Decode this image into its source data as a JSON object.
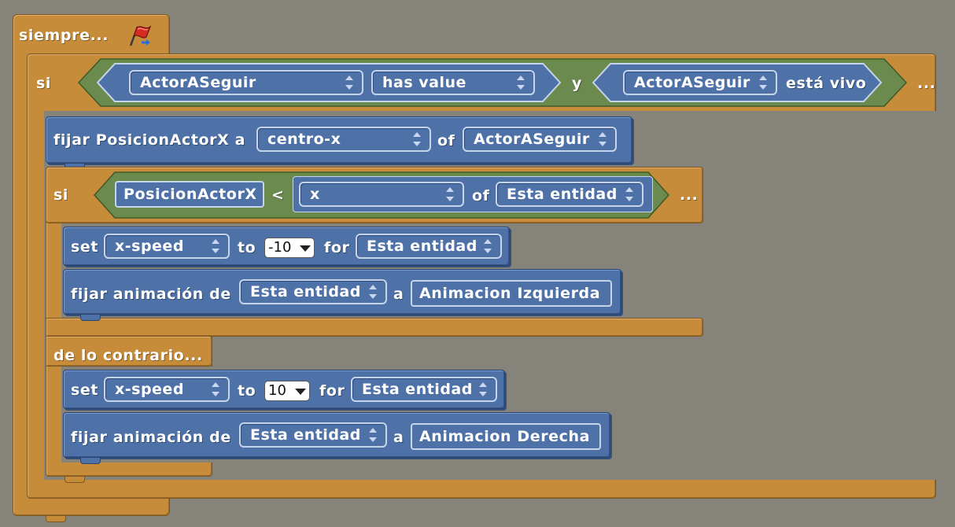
{
  "forever_block": {
    "label": "siempre...",
    "icon": "green-flag-icon"
  },
  "outer_if": {
    "label": "si",
    "more": "...",
    "condition": {
      "left": {
        "dropdown": "ActorASeguir",
        "operator": "has value"
      },
      "joiner": "y",
      "right": {
        "dropdown": "ActorASeguir",
        "suffix": "está vivo"
      }
    }
  },
  "set_posx": {
    "label": "fijar PosicionActorX a",
    "property": "centro-x",
    "of": "of",
    "target": "ActorASeguir"
  },
  "inner_if": {
    "label": "si",
    "more": "...",
    "condition": {
      "var": "PosicionActorX",
      "op": "<",
      "property": "x",
      "of": "of",
      "target": "Esta entidad"
    }
  },
  "then_blocks": [
    {
      "set": "set",
      "property": "x-speed",
      "to": "to",
      "value": "-10",
      "for": "for",
      "target": "Esta entidad"
    },
    {
      "label": "fijar animación de",
      "target": "Esta entidad",
      "a": "a",
      "animation": "Animacion Izquierda"
    }
  ],
  "else_label": "de lo contrario...",
  "else_blocks": [
    {
      "set": "set",
      "property": "x-speed",
      "to": "to",
      "value": "10",
      "for": "for",
      "target": "Esta entidad"
    },
    {
      "label": "fijar animación de",
      "target": "Esta entidad",
      "a": "a",
      "animation": "Animacion Derecha"
    }
  ],
  "colors": {
    "control": "#c68c3a",
    "action": "#4e72a8",
    "boolean": "#6b8a4e",
    "background": "#86837a"
  }
}
